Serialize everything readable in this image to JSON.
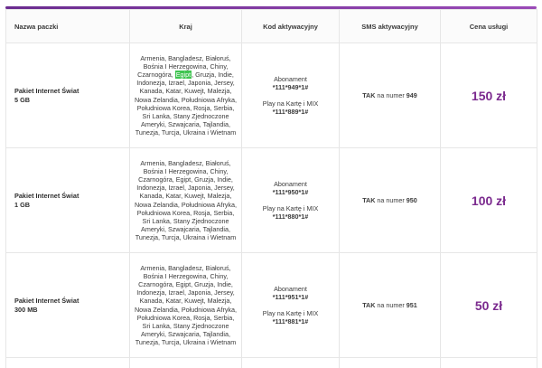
{
  "headers": {
    "package": "Nazwa paczki",
    "country": "Kraj",
    "code": "Kod aktywacyjny",
    "sms": "SMS aktywacyjny",
    "price": "Cena usługi"
  },
  "countries_before": "Armenia, Bangladesz, Białoruś, Bośnia I Herzegowina, Chiny, Czarnogóra,",
  "countries_highlight": "Egipt",
  "countries_after": ", Gruzja, Indie, Indonezja, Izrael, Japonia, Jersey, Kanada, Katar, Kuwejt, Malezja, Nowa Zelandia, Południowa Afryka, Południowa Korea, Rosja, Serbia, Sri Lanka, Stany Zjednoczone Ameryki, Szwajcaria, Tajlandia, Tunezja, Turcja, Ukraina i Wietnam",
  "countries_full": "Armenia, Bangladesz, Białoruś, Bośnia I Herzegowina, Chiny, Czarnogóra, Egipt, Gruzja, Indie, Indonezja, Izrael, Japonia, Jersey, Kanada, Katar, Kuwejt, Malezja, Nowa Zelandia, Południowa Afryka, Południowa Korea, Rosja, Serbia, Sri Lanka, Stany Zjednoczone Ameryki, Szwajcaria, Tajlandia, Tunezja, Turcja, Ukraina i Wietnam",
  "labels": {
    "abonament": "Abonament",
    "play": "Play na Kartę i MIX",
    "tak": "TAK",
    "na_numer": " na numer "
  },
  "rows": [
    {
      "name_line1": "Pakiet Internet Świat",
      "name_line2": "5 GB",
      "code_abo": "*111*949*1#",
      "code_play": "*111*889*1#",
      "sms_number": "949",
      "price": "150 zł"
    },
    {
      "name_line1": "Pakiet Internet Świat",
      "name_line2": "1 GB",
      "code_abo": "*111*950*1#",
      "code_play": "*111*880*1#",
      "sms_number": "950",
      "price": "100 zł"
    },
    {
      "name_line1": "Pakiet Internet Świat",
      "name_line2": "300 MB",
      "code_abo": "*111*951*1#",
      "code_play": "*111*881*1#",
      "sms_number": "951",
      "price": "50 zł"
    }
  ],
  "colors": {
    "accent": "#7b2a8e",
    "highlight": "#3ec44f"
  }
}
